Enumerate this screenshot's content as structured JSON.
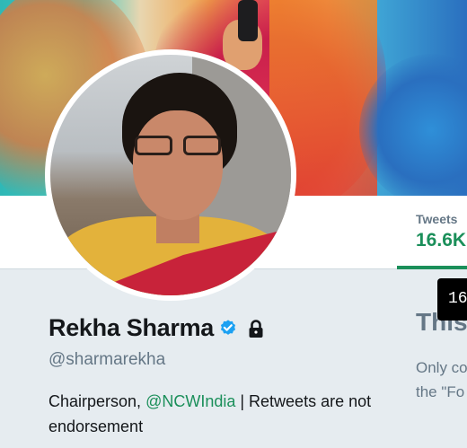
{
  "profile": {
    "name": "Rekha Sharma",
    "handle": "@sharmarekha",
    "bio_prefix": "Chairperson, ",
    "bio_mention": "@NCWIndia",
    "bio_suffix": " | Retweets are not endorsement",
    "verified_icon": "verified-badge-icon",
    "protected_icon": "lock-icon"
  },
  "stats": {
    "tweets_label": "Tweets",
    "tweets_value": "16.6K"
  },
  "tooltip": {
    "text": "16"
  },
  "teaser": {
    "title": "This",
    "line1": "Only co",
    "line2": "the \"Fo"
  },
  "colors": {
    "accent": "#1b8f5a",
    "verified": "#1da1f2",
    "muted": "#657786",
    "background": "#e6ecf0"
  }
}
